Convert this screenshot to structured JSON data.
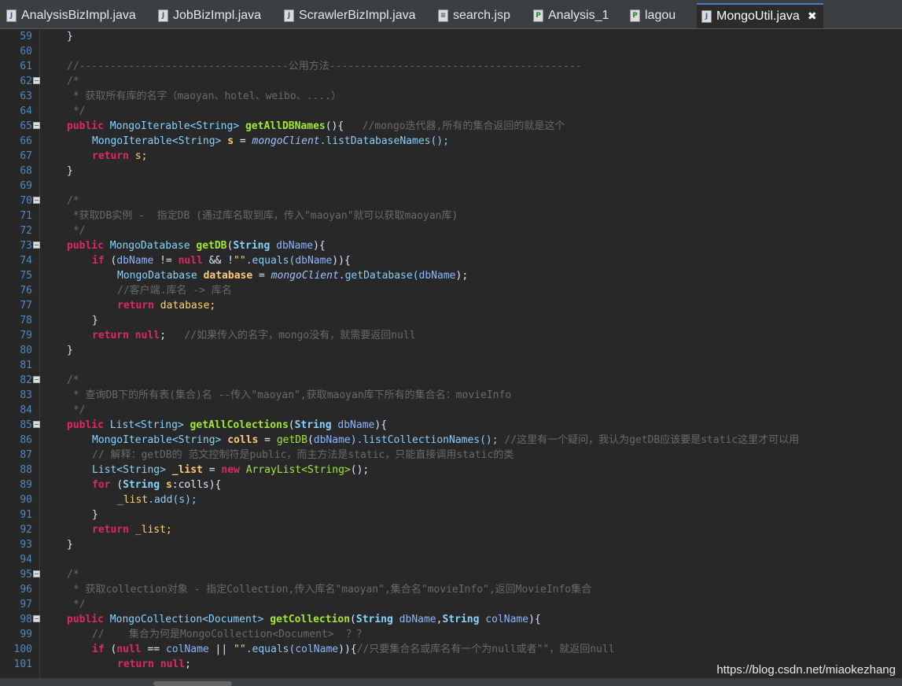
{
  "tabs": [
    {
      "label": "AnalysisBizImpl.java",
      "icon": "java-file-icon",
      "active": false
    },
    {
      "label": "JobBizImpl.java",
      "icon": "java-file-icon",
      "active": false
    },
    {
      "label": "ScrawlerBizImpl.java",
      "icon": "java-file-icon",
      "active": false
    },
    {
      "label": "search.jsp",
      "icon": "jsp-file-icon",
      "active": false
    },
    {
      "label": "Analysis_1",
      "icon": "class-file-icon",
      "active": false
    },
    {
      "label": "lagou",
      "icon": "class-file-icon",
      "active": false
    },
    {
      "label": "MongoUtil.java",
      "icon": "java-file-icon",
      "active": true
    }
  ],
  "close_glyph": "✖",
  "line_numbers": [
    "59",
    "60",
    "61",
    "62",
    "63",
    "64",
    "65",
    "66",
    "67",
    "68",
    "69",
    "70",
    "71",
    "72",
    "73",
    "74",
    "75",
    "76",
    "77",
    "78",
    "79",
    "80",
    "81",
    "82",
    "83",
    "84",
    "85",
    "86",
    "87",
    "88",
    "89",
    "90",
    "91",
    "92",
    "93",
    "94",
    "95",
    "96",
    "97",
    "98",
    "99",
    "100",
    "101"
  ],
  "fold_lines": [
    62,
    65,
    70,
    73,
    82,
    85,
    95,
    98
  ],
  "code": {
    "l59": "}",
    "l61": "//----------------------------------公用方法-----------------------------------------",
    "l62": "/*",
    "l63": " * 获取所有库的名字（maoyan、hotel、weibo、....）",
    "l64": " */",
    "l65a": "public ",
    "l65b": "MongoIterable<String> ",
    "l65c": "getAllDBNames",
    "l65d": "(){   ",
    "l65e": "//mongo迭代器,所有的集合返回的就是这个",
    "l66a": "MongoIterable<String> ",
    "l66b": "s",
    "l66c": " = ",
    "l66d": "mongoClient",
    "l66e": ".listDatabaseNames();",
    "l67a": "return ",
    "l67b": "s;",
    "l68": "}",
    "l70": "/*",
    "l71": " *获取DB实例 -  指定DB (通过库名取到库，传入\"maoyan\"就可以获取maoyan库)",
    "l72": " */",
    "l73a": "public ",
    "l73b": "MongoDatabase ",
    "l73c": "getDB",
    "l73d": "(",
    "l73e": "String ",
    "l73f": "dbName",
    "l73g": "){",
    "l74a": "if ",
    "l74b": "(",
    "l74c": "dbName",
    "l74d": " != ",
    "l74e": "null",
    "l74f": " && !",
    "l74g": "\"\"",
    "l74h": ".equals(",
    "l74i": "dbName",
    "l74j": ")){",
    "l75a": "MongoDatabase ",
    "l75b": "database",
    "l75c": " = ",
    "l75d": "mongoClient",
    "l75e": ".getDatabase(",
    "l75f": "dbName",
    "l75g": ");",
    "l76": "//客户端.库名 -> 库名",
    "l77a": "return ",
    "l77b": "database;",
    "l78": "}",
    "l79a": "return ",
    "l79b": "null",
    "l79c": ";   ",
    "l79d": "//如果传入的名字，mongo没有，就需要返回null",
    "l80": "}",
    "l82": "/*",
    "l83": " * 查询DB下的所有表(集合)名 --传入\"maoyan\",获取maoyan库下所有的集合名：movieInfo",
    "l84": " */",
    "l85a": "public ",
    "l85b": "List<String> ",
    "l85c": "getAllColections",
    "l85d": "(",
    "l85e": "String ",
    "l85f": "dbName",
    "l85g": "){",
    "l86a": "MongoIterable<String> ",
    "l86b": "colls",
    "l86c": " = ",
    "l86d": "getDB",
    "l86e": "(",
    "l86f": "dbName",
    "l86g": ").listCollectionNames(); ",
    "l86h": "//这里有一个疑问，我认为getDB应该要是static这里才可以用",
    "l87": "// 解释：getDB的 范文控制符是public，而主方法是static，只能直接调用static的类",
    "l88a": "List<String> ",
    "l88b": "_list",
    "l88c": " = ",
    "l88d": "new ",
    "l88e": "ArrayList<String>",
    "l88f": "();",
    "l89a": "for ",
    "l89b": "(",
    "l89c": "String ",
    "l89d": "s",
    "l89e": ":colls){",
    "l90a": "_list",
    "l90b": ".add(s);",
    "l91": "}",
    "l92a": "return ",
    "l92b": "_list;",
    "l93": "}",
    "l95": "/*",
    "l96": " * 获取collection对象 - 指定Collection,传入库名\"maoyan\",集合名\"movieInfo\",返回MovieInfo集合",
    "l97": " */",
    "l98a": "public ",
    "l98b": "MongoCollection<Document> ",
    "l98c": "getCollection",
    "l98d": "(",
    "l98e": "String ",
    "l98f": "dbName",
    "l98g": ",",
    "l98h": "String ",
    "l98i": "colName",
    "l98j": "){",
    "l99": "//    集合为何是MongoCollection<Document>  ？？",
    "l100a": "if ",
    "l100b": "(",
    "l100c": "null",
    "l100d": " == ",
    "l100e": "colName",
    "l100f": " || ",
    "l100g": "\"\"",
    "l100h": ".equals(",
    "l100i": "colName",
    "l100j": ")){",
    "l100k": "//只要集合名或库名有一个为null或者\"\"，就返回null",
    "l101a": "return ",
    "l101b": "null",
    "l101c": ";"
  },
  "watermark": "https://blog.csdn.net/miaokezhang"
}
